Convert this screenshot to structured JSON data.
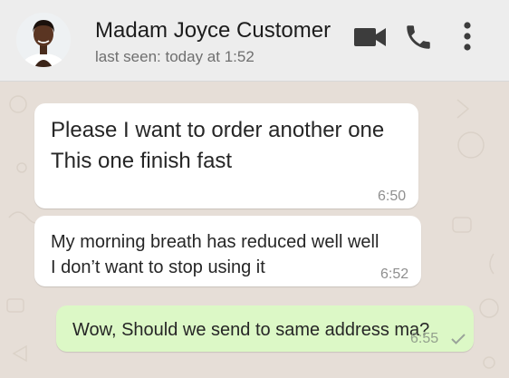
{
  "header": {
    "contact_name": "Madam Joyce Customer",
    "status": "last seen: today at 1:52",
    "icons": [
      "avatar",
      "video-call-icon",
      "voice-call-icon",
      "more-options-icon"
    ]
  },
  "messages": [
    {
      "direction": "incoming",
      "lines": [
        "Please I want to order another one",
        "This one finish fast"
      ],
      "time": "6:50"
    },
    {
      "direction": "incoming",
      "lines": [
        "My morning breath has reduced well well",
        "I don’t want to stop using it"
      ],
      "time": "6:52"
    },
    {
      "direction": "outgoing",
      "lines": [
        "Wow, Should we send to same address ma?"
      ],
      "time": "6:55",
      "status_icon": "single-check-icon"
    }
  ],
  "colors": {
    "header_bg": "#ededed",
    "chat_bg": "#e6ded7",
    "incoming_bubble": "#ffffff",
    "outgoing_bubble": "#dcf8c6",
    "icon": "#3c3c3c",
    "check": "#9aa39a"
  }
}
